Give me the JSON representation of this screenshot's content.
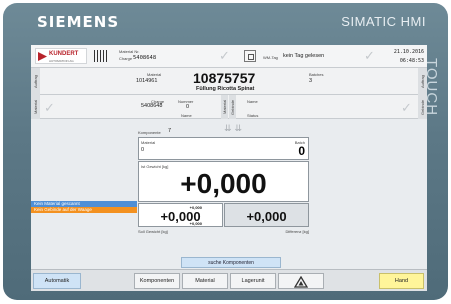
{
  "frame": {
    "brand": "SIEMENS",
    "model": "SIMATIC HMI",
    "side_label": "TOUCH"
  },
  "top": {
    "logo_brand": "KUNDERT",
    "logo_sub": "AUTOMATION AG",
    "material_nr_label": "Material Nr.",
    "charge_label": "Charge",
    "charge_value": "5408648",
    "wm_tag_label": "WM-Tag",
    "status_text": "kein Tag gelesen",
    "date": "21.10.2016",
    "time": "06:48:53"
  },
  "order": {
    "side_label": "Auftrag",
    "right_label": "Auftrag",
    "material_label": "Material",
    "material_value": "1014961",
    "order_number": "10875757",
    "order_name": "Füllung Ricotta Spinat",
    "batches_label": "Batches",
    "batches_value": "3"
  },
  "material": {
    "side_label": "Material",
    "right_label": "Gebinde",
    "charge_label": "Charge",
    "charge_value": "5408648",
    "nummer_label": "Nummer",
    "nummer_value": "0",
    "name_label": "Name",
    "mid_label_1": "Material",
    "mid_label_2": "Gebinde",
    "name2_label": "Name",
    "status_label": "Status"
  },
  "weighing": {
    "komponente_label": "Komponente",
    "komponente_value": "7",
    "material_label": "Material",
    "material_value": "0",
    "batch_label": "Batch",
    "batch_value": "0",
    "gesamt_label": "Ist Gewicht [kg]",
    "main_value": "+0,000",
    "sub_top": "+0,000",
    "sub_main": "+0,000",
    "sub_bottom": "+0,000",
    "right_value": "+0,000",
    "soll_label": "Soll Gewicht [kg]",
    "diff_label": "Differenz [kg]"
  },
  "messages": {
    "info": "Kein Material gescannt",
    "warning": "Kein Gebinde auf der Waage"
  },
  "bottom": {
    "search_label": "suche Komponenten",
    "buttons": {
      "automatik": "Automatik",
      "komponenten": "Komponenten",
      "material": "Material",
      "lagerunit": "Lagerunit",
      "hand": "Hand"
    }
  },
  "colors": {
    "accent_blue": "#cfe3f6",
    "warning_orange": "#f39120",
    "info_blue": "#4f8fd6",
    "hand_yellow": "#fff59a"
  }
}
